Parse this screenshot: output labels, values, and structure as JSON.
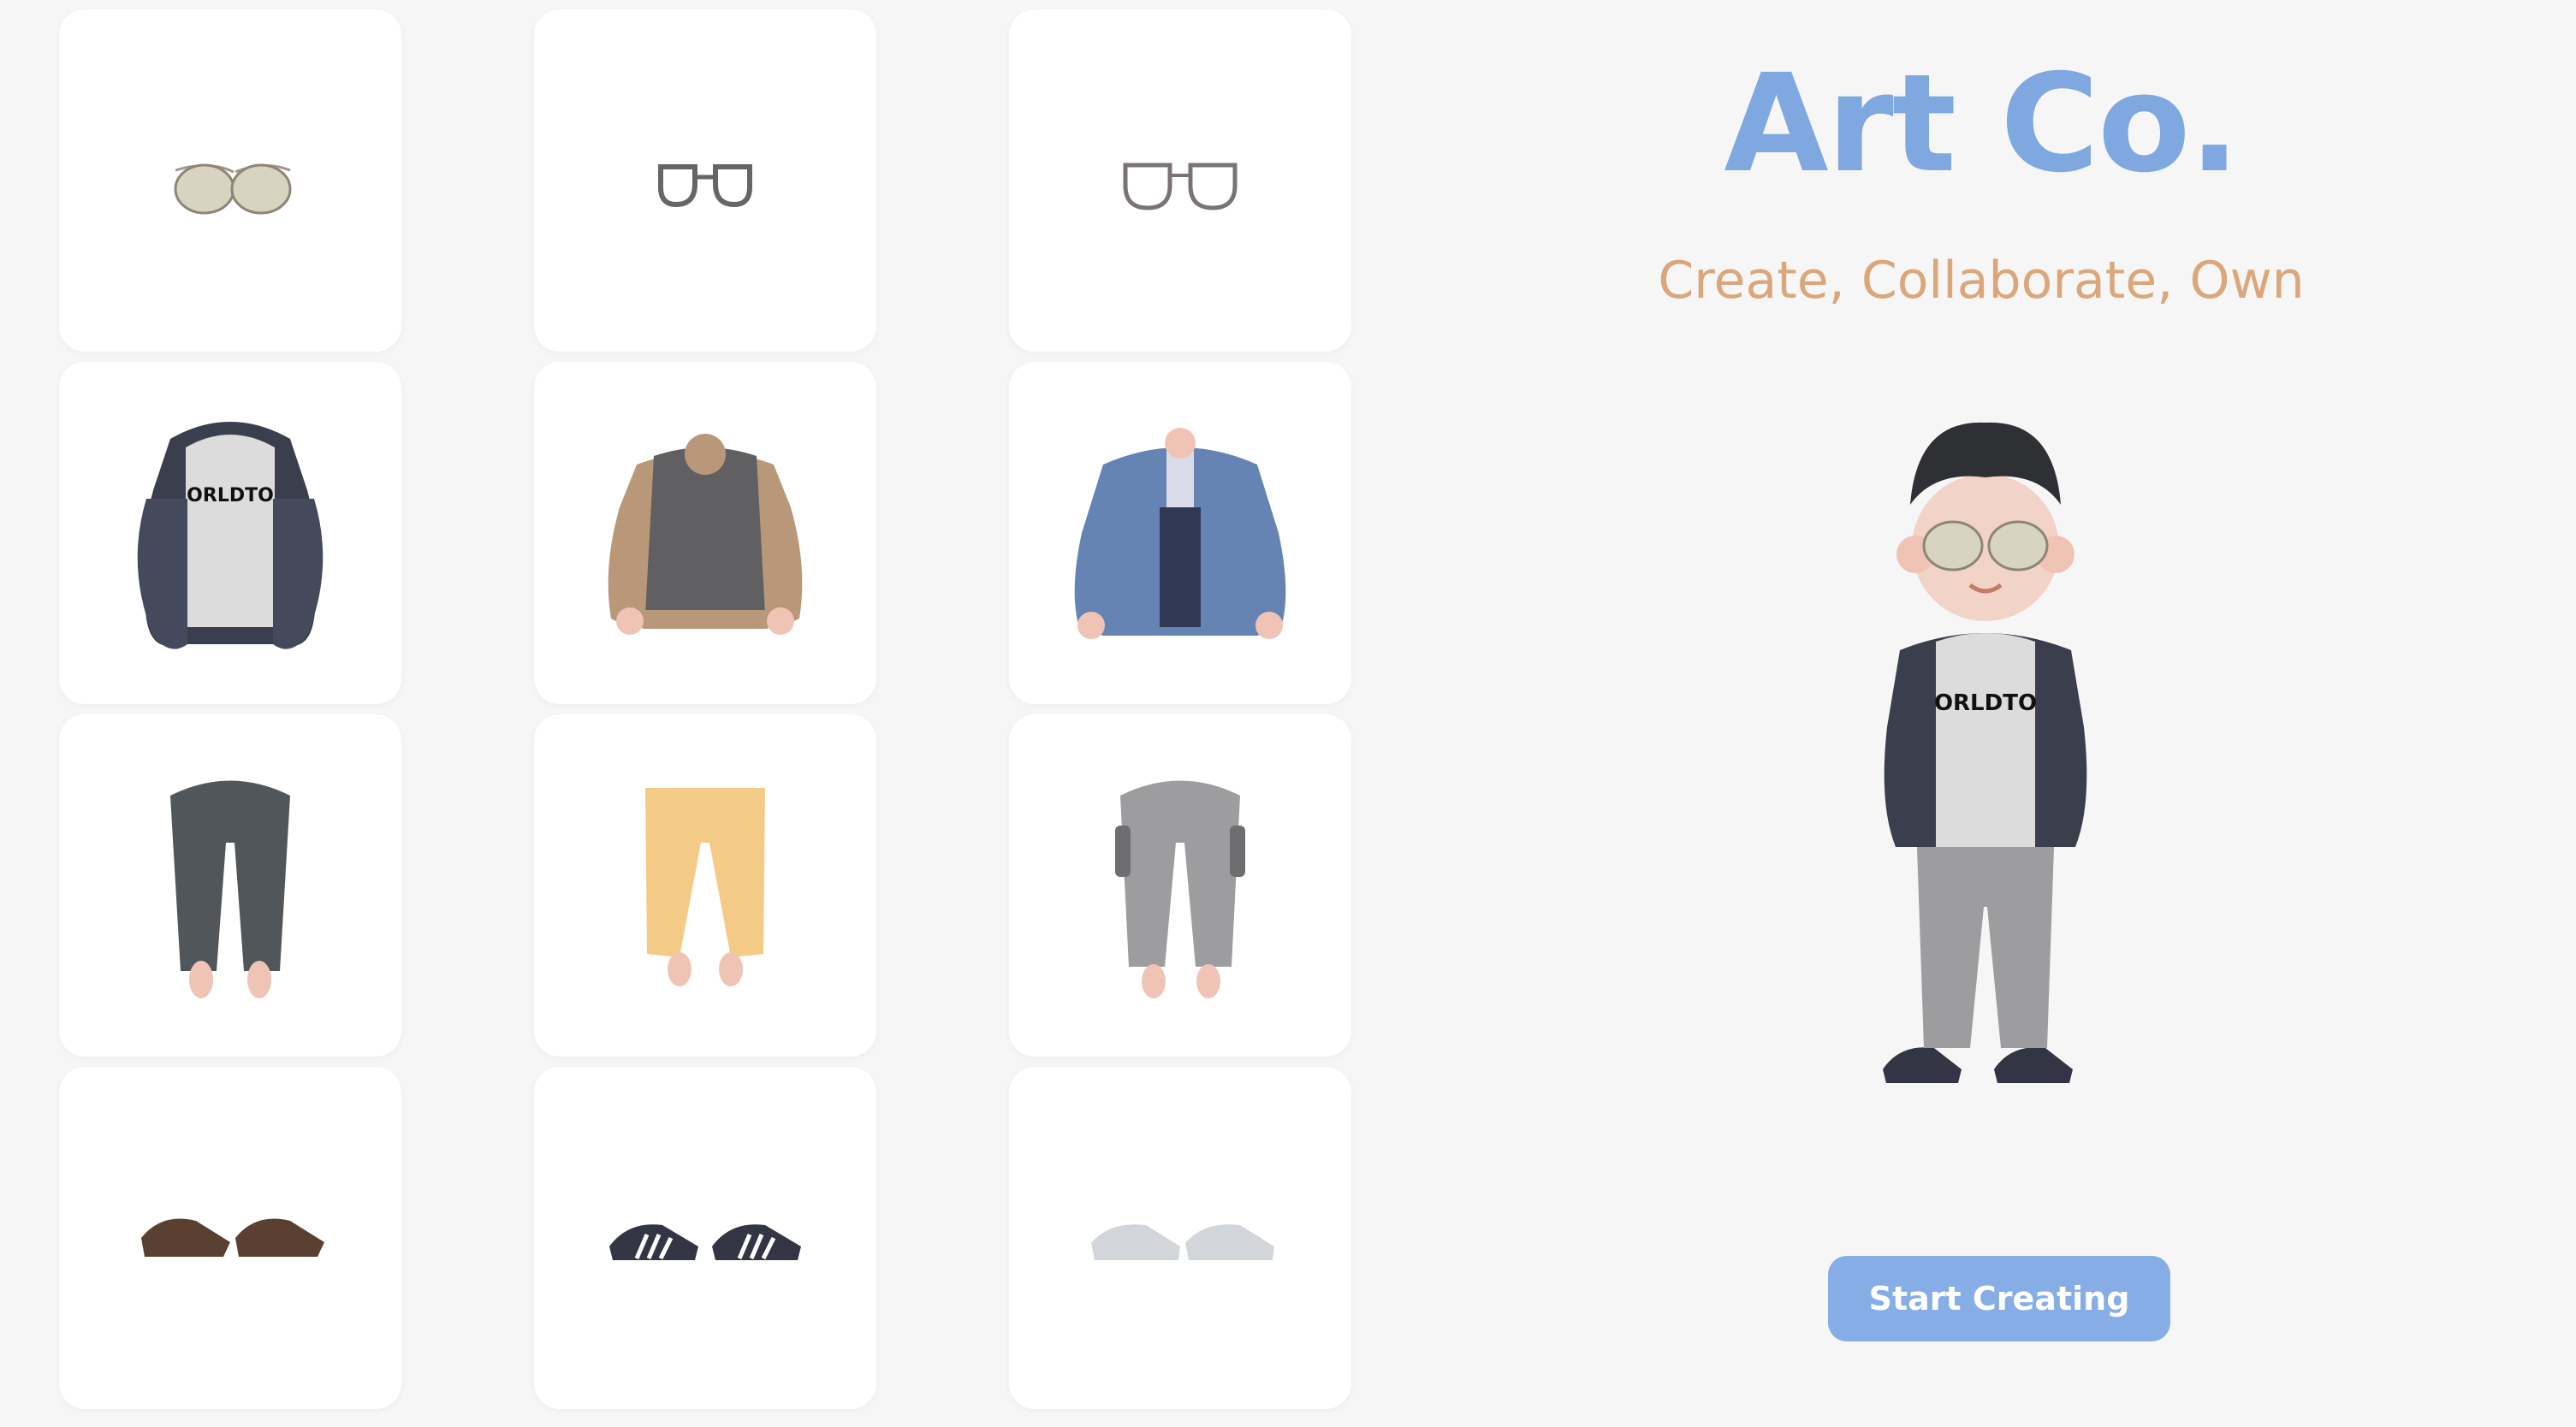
{
  "brand": {
    "title": "Art Co.",
    "tagline": "Create, Collaborate, Own",
    "accent_color": "#7fa8e0",
    "tagline_color": "#dba77a"
  },
  "items": {
    "eyewear": [
      {
        "name": "Aviator Sunglasses",
        "icon": "aviator-glasses-icon"
      },
      {
        "name": "Square Glasses Dark",
        "icon": "square-glasses-icon"
      },
      {
        "name": "Square Glasses Grey",
        "icon": "square-glasses-grey-icon"
      }
    ],
    "tops": [
      {
        "name": "Hoodie Jacket",
        "icon": "hoodie-jacket-icon",
        "print": "ORLDTO"
      },
      {
        "name": "Sweater Vest",
        "icon": "sweater-vest-icon"
      },
      {
        "name": "Blue Blazer",
        "icon": "blue-blazer-icon"
      }
    ],
    "bottoms": [
      {
        "name": "Charcoal Trousers",
        "icon": "charcoal-trousers-icon"
      },
      {
        "name": "Yellow Trousers",
        "icon": "yellow-trousers-icon"
      },
      {
        "name": "Grey Cargo Pants",
        "icon": "grey-cargo-pants-icon"
      }
    ],
    "shoes": [
      {
        "name": "Brown Dress Shoes",
        "icon": "brown-shoes-icon"
      },
      {
        "name": "Striped Sneakers",
        "icon": "striped-sneakers-icon"
      },
      {
        "name": "Grey Sneakers",
        "icon": "grey-sneakers-icon"
      }
    ]
  },
  "avatar": {
    "shirt_print": "ORLDTO"
  },
  "cta": {
    "label": "Start Creating",
    "color": "#86ade6"
  }
}
